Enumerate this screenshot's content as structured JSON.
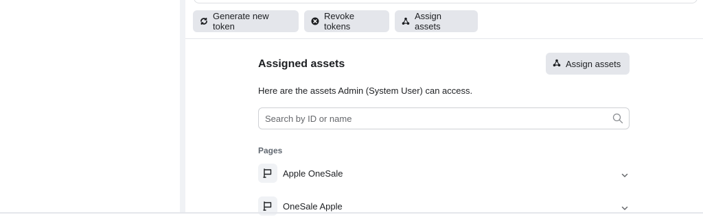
{
  "toolbar": {
    "generate_label": "Generate new token",
    "revoke_label": "Revoke tokens",
    "assign_label": "Assign assets"
  },
  "assigned": {
    "title": "Assigned assets",
    "assign_button_label": "Assign assets",
    "description": "Here are the assets Admin (System User) can access.",
    "search": {
      "placeholder": "Search by ID or name",
      "value": ""
    },
    "section_label": "Pages",
    "pages": [
      {
        "label": "Apple OneSale"
      },
      {
        "label": "OneSale Apple"
      }
    ]
  },
  "icons": {
    "generate": "refresh-icon",
    "revoke": "close-circle-icon",
    "assign": "nodes-icon",
    "search": "search-icon",
    "page": "flag-icon",
    "expand": "chevron-down-icon"
  }
}
